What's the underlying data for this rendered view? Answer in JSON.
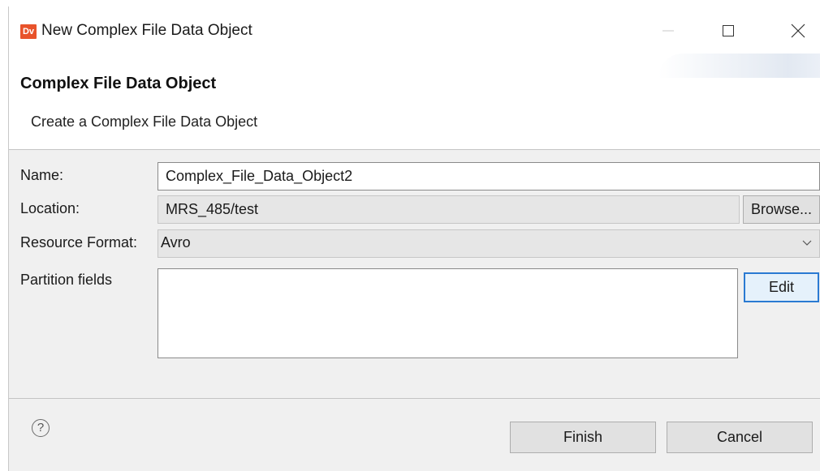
{
  "window": {
    "app_icon_text": "Dv",
    "title": "New Complex File Data Object"
  },
  "header": {
    "title": "Complex File Data Object",
    "subtitle": "Create a Complex File Data Object"
  },
  "form": {
    "name_label": "Name:",
    "name_value": "Complex_File_Data_Object2",
    "location_label": "Location:",
    "location_value": "MRS_485/test",
    "browse_label": "Browse...",
    "format_label": "Resource Format:",
    "format_value": "Avro",
    "partition_label": "Partition fields",
    "edit_label": "Edit"
  },
  "footer": {
    "help_symbol": "?",
    "finish_label": "Finish",
    "cancel_label": "Cancel"
  },
  "colors": {
    "app_icon": "#e8532b",
    "focus_border": "#2a7ad2",
    "dialog_bg": "#f0f0f0"
  },
  "icons": [
    "app-logo-icon",
    "minimize-icon",
    "maximize-icon",
    "close-icon",
    "chevron-down-icon",
    "help-icon"
  ]
}
